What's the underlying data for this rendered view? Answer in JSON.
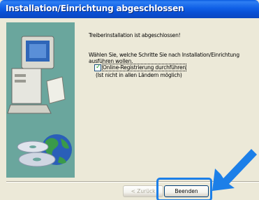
{
  "window": {
    "title": "Installation/Einrichtung abgeschlossen"
  },
  "content": {
    "status": "Treiberinstallation ist abgeschlossen!",
    "instruction_line1": "Wählen Sie, welche Schritte Sie nach Installation/Einrichtung",
    "instruction_line2": "ausführen wollen.",
    "checkbox_label": "Online-Registrierung durchführen",
    "checkbox_checked": true,
    "note": "(Ist nicht in allen Ländern möglich)"
  },
  "buttons": {
    "back_label": "< Zurück",
    "finish_label": "Beenden"
  },
  "colors": {
    "title_bar": "#0a54d8",
    "side_panel": "#6aa69d",
    "dialog_bg": "#ece9d8",
    "highlight": "#1c7fe8"
  },
  "icons": {
    "computer": "computer-icon",
    "cd": "cd-icon",
    "globe": "globe-icon",
    "arrow": "pointer-arrow-icon"
  }
}
